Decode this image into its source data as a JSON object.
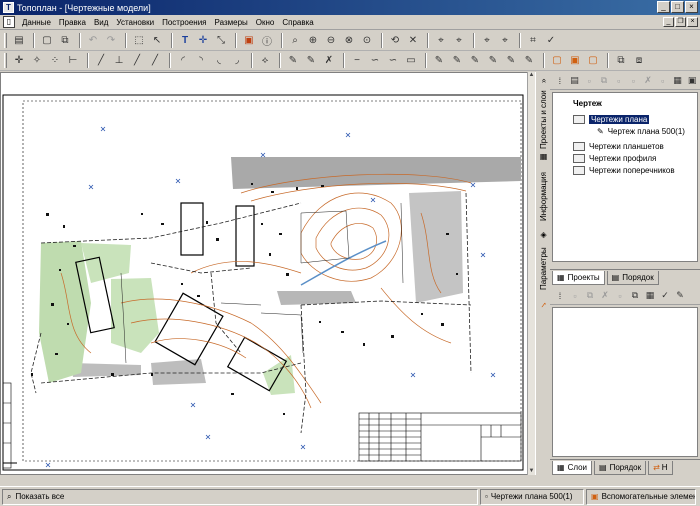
{
  "window": {
    "title": "Топоплан - [Чертежные модели]",
    "app_icon": "T"
  },
  "menu": [
    "Данные",
    "Правка",
    "Вид",
    "Установки",
    "Построения",
    "Размеры",
    "Окно",
    "Справка"
  ],
  "toolbar_icons": [
    "folder-icon",
    "save-icon",
    "copy-icon",
    "undo-icon",
    "redo-icon",
    "select-icon",
    "pointer-icon",
    "text-icon",
    "cross-icon",
    "ruler-icon",
    "frame-icon",
    "info-icon",
    "zoom-icon",
    "zoom-in-icon",
    "zoom-out-icon",
    "zoom-window-icon",
    "zoom-all-icon",
    "rotate-icon",
    "fit-icon",
    "snap-icon",
    "grid-icon",
    "layer-icon",
    "check-icon"
  ],
  "side_tabs": {
    "projects": "Проекты и слои",
    "info": "Информация",
    "params": "Параметры"
  },
  "tree": {
    "root": "Чертеж",
    "items": [
      {
        "label": "Чертежи плана",
        "selected": true
      },
      {
        "label": "Чертеж плана 500(1)",
        "selected": false
      },
      {
        "label": "Чертежи планшетов",
        "selected": false
      },
      {
        "label": "Чертежи профиля",
        "selected": false
      },
      {
        "label": "Чертежи поперечников",
        "selected": false
      }
    ]
  },
  "panel_tabs_top": {
    "projects": "Проекты",
    "order": "Порядок"
  },
  "panel_tabs_bottom": {
    "layers": "Слои",
    "order": "Порядок",
    "third": "Н"
  },
  "status": {
    "show_all": "Показать все",
    "drawing": "Чертежи плана 500(1)",
    "element": "Вспомогательные элемент"
  }
}
